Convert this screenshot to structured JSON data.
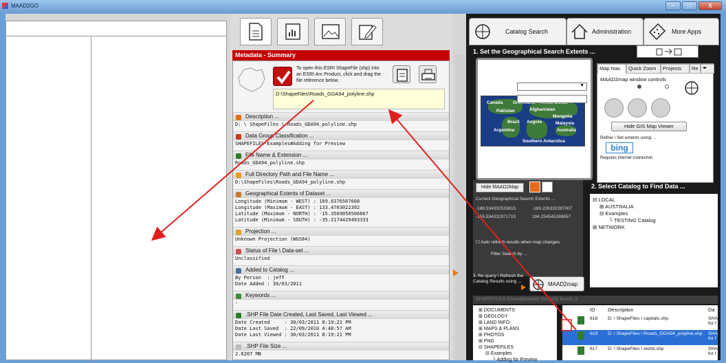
{
  "window": {
    "title": "MAAD2GO",
    "min": "–",
    "max": "□",
    "close": "X"
  },
  "meta": {
    "header": "Metadata - Summary",
    "instruction": "To open this ESRI ShapeFile (shp) into an ESRI Arc Product, click and drag the file reference below.",
    "file_ref": "D:\\ShapeFiles\\Roads_GDA94_polyline.shp",
    "sections": [
      {
        "label": "Description ...",
        "value": "D: \\ ShapeFiles \\ Roads_GDA94_polyline.shp",
        "color": "#e07010"
      },
      {
        "label": "Data Group Classification ...",
        "value": "SHAPEFILES-Examples#Adding for Preview",
        "color": "#c63b1b"
      },
      {
        "label": "File Name & Extension ...",
        "value": "Roads_GDA94_polyline.shp",
        "color": "#2f7d2f"
      },
      {
        "label": "Full Directory Path and File Name ...",
        "value": "D:\\ShapeFiles\\Roads_GDA94_polyline.shp",
        "color": "#e89b1d"
      },
      {
        "label": "Geographical Extents of Dataset ...",
        "value": "Longitude (Minimum - WEST) : 109.6376567608\nLongitude (Maximum - EAST) : 133.4703022392\nLatitude (Maximum - NORTH) : -15.3569050506667\nLatitude (Minimum - SOUTH) : -35.2174429493333",
        "color": "#c87a30"
      },
      {
        "label": "Projection ...",
        "value": "Unknown Projection (WGS84)",
        "color": "#e0a030"
      },
      {
        "label": "Status of File \\ Data-set ...",
        "value": "Unclassified",
        "color": "#d05050"
      },
      {
        "label": "Added to Catalog ...",
        "value": "By Person  : jeff\nDate Added : 30/03/2011",
        "color": "#4a6fa0"
      },
      {
        "label": "Keywords ...",
        "value": "-",
        "color": "#3a8a3a"
      },
      {
        "label": ".SHP File Date Created, Last Saved, Last Viewed ...",
        "value": "Date Created     : 30/03/2011 8:19:21 PM\nDate Last Saved  : 22/09/2010 4:48:57 AM\nDate Last Viewed : 30/03/2011 8:19:21 PM",
        "color": "#2f7d2f"
      },
      {
        "label": ".SHP File Size ...",
        "value": "2.6207 MB",
        "color": "#bbbbbb"
      }
    ]
  },
  "right": {
    "tabs": [
      "Catalog Search",
      "Administration",
      "More Apps"
    ],
    "step1": "1. Set the Geographical Search Extents ...",
    "map_labels": [
      "Canada",
      "Greenland",
      "Arctic Ocean",
      "Pakistan",
      "Afghanistan",
      "Mongolia",
      "Malaysia",
      "Brazil",
      "Angola",
      "Australia",
      "Argentina",
      "Southern Antarctica"
    ],
    "nav_tabs": [
      "Map Nav.",
      "Quick Zoom",
      "Projects",
      "Re"
    ],
    "map_controls": "MAAD2map window controls",
    "hide_gis": "Hide GIS Map Viewer",
    "refine": "Refine \\ Set extents using ...",
    "bing": "bing",
    "requires": "Requires internet connection",
    "hide_map": "Hide MAAD2Map",
    "current_extents": "Current Geographical Search Extents ...",
    "ext_vals": [
      "-188.534332533815",
      "-183.226332287007",
      "-155.534332971715",
      "194.254545286957"
    ],
    "auto_refresh": "Auto refresh results when map changes.",
    "filter": "Filter Search by ...",
    "requery": "3. Re-query \\ Refresh the Catalog Results using ...",
    "maad2map": "MAAD2map",
    "step2": "2. Select Catalog to Find Data ...",
    "catalog_tree": [
      "LOCAL",
      "AUSTRALIA",
      "Examples",
      "TESTING Catalog",
      "NETWORK"
    ],
    "results_bar": "SHAPEFILES-Examples#Add    Records found: 3",
    "left_tree": [
      "DOCUMENTS",
      "GEOLOGY",
      "LAND INFO",
      "MAPS & PLANS",
      "PHOTOS",
      "PNG",
      "SHAPEFILES",
      "Examples",
      "Adding for Preview"
    ],
    "results_head": {
      "id": "ID",
      "desc": "Description",
      "da": "Da"
    },
    "results": [
      {
        "id": "618",
        "desc": "D: \\ ShapeFiles \\ capitals.shp",
        "extra": "SHA for f"
      },
      {
        "id": "619",
        "desc": "D: \\ ShapeFiles \\ Roads_GDA94_polyline.shp",
        "extra": "SHA for f"
      },
      {
        "id": "617",
        "desc": "D: \\ ShapeFiles \\ world.shp",
        "extra": "SHA for f"
      }
    ]
  }
}
